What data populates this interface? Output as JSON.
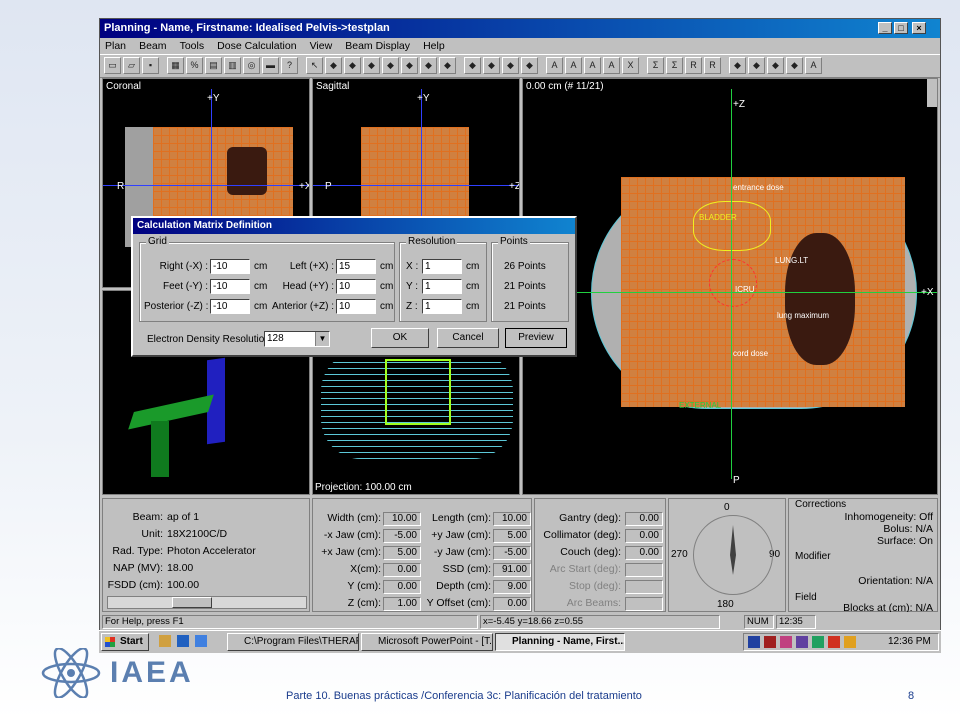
{
  "window": {
    "title": "Planning - Name, Firstname: Idealised Pelvis->testplan",
    "minimize": "_",
    "maximize": "□",
    "close": "×"
  },
  "menu": [
    "Plan",
    "Beam",
    "Tools",
    "Dose Calculation",
    "View",
    "Beam Display",
    "Help"
  ],
  "toolbar_icons": [
    "new-icon",
    "open-icon",
    "save-icon",
    "grid-icon",
    "percent-icon",
    "table-icon",
    "matrix-icon",
    "zoom-icon",
    "measure-icon",
    "help-icon",
    "arrow-icon",
    "beam-icon",
    "tool-icon",
    "tool2-icon",
    "tool3-icon",
    "tool4-icon",
    "tool5-icon",
    "tool6-icon",
    "layout-icon",
    "layout2-icon",
    "layout3-icon",
    "layout4-icon",
    "text-icon",
    "text2-icon",
    "text3-icon",
    "text4-icon",
    "text5-icon",
    "sigma-icon",
    "sigma2-icon",
    "rx-icon",
    "rx2-icon",
    "view-icon",
    "view2-icon",
    "view3-icon",
    "view4-icon",
    "font-icon"
  ],
  "views": {
    "coronal": {
      "label": "Coronal",
      "y": "+Y",
      "left": "R",
      "right": "+X"
    },
    "sagittal": {
      "label": "Sagittal",
      "y": "+Y",
      "left": "P",
      "right": "+Z",
      "projection": "Projection: 100.00 cm"
    },
    "axial": {
      "label": "0.00 cm (# 11/21)",
      "z": "+Z",
      "x": "+X",
      "p": "P",
      "annotations": {
        "entrance": "entrance dose",
        "bladder": "BLADDER",
        "lung_lt": "LUNG.LT",
        "icru": "ICRU",
        "lung_max": "lung maximum",
        "cord": "cord dose",
        "external": "EXTERNAL"
      }
    }
  },
  "dialog": {
    "title": "Calculation Matrix Definition",
    "grid_label": "Grid",
    "resolution_label": "Resolution",
    "points_label": "Points",
    "right_label": "Right (-X) :",
    "right_value": "-10",
    "feet_label": "Feet (-Y) :",
    "feet_value": "-10",
    "posterior_label": "Posterior (-Z) :",
    "posterior_value": "-10",
    "left_label": "Left (+X) :",
    "left_value": "15",
    "head_label": "Head (+Y) :",
    "head_value": "10",
    "anterior_label": "Anterior (+Z) :",
    "anterior_value": "10",
    "unit": "cm",
    "res_x_label": "X :",
    "res_x": "1",
    "res_y_label": "Y :",
    "res_y": "1",
    "res_z_label": "Z :",
    "res_z": "1",
    "points_x": "26 Points",
    "points_y": "21 Points",
    "points_z": "21 Points",
    "edr_label": "Electron Density Resolution:",
    "edr_value": "128",
    "ok": "OK",
    "cancel": "Cancel",
    "preview": "Preview"
  },
  "beam_info": {
    "beam_label": "Beam:",
    "beam": "ap of 1",
    "unit_label": "Unit:",
    "unit": "18X2100C/D",
    "radtype_label": "Rad. Type:",
    "radtype": "Photon Accelerator",
    "nap_label": "NAP (MV):",
    "nap": "18.00",
    "fsdd_label": "FSDD (cm):",
    "fsdd": "100.00"
  },
  "beam_geom": {
    "width_label": "Width (cm):",
    "width": "10.00",
    "xjaw_neg_label": "-x Jaw (cm):",
    "xjaw_neg": "-5.00",
    "xjaw_pos_label": "+x Jaw (cm):",
    "xjaw_pos": "5.00",
    "x_label": "X(cm):",
    "x": "0.00",
    "y_label": "Y (cm):",
    "y": "0.00",
    "z_label": "Z (cm):",
    "z": "1.00",
    "length_label": "Length (cm):",
    "length": "10.00",
    "yjaw_pos_label": "+y Jaw (cm):",
    "yjaw_pos": "5.00",
    "yjaw_neg_label": "-y Jaw (cm):",
    "yjaw_neg": "-5.00",
    "ssd_label": "SSD (cm):",
    "ssd": "91.00",
    "depth_label": "Depth (cm):",
    "depth": "9.00",
    "yoffset_label": "Y Offset (cm):",
    "yoffset": "0.00"
  },
  "gantry": {
    "gantry_label": "Gantry (deg):",
    "gantry": "0.00",
    "collimator_label": "Collimator (deg):",
    "collimator": "0.00",
    "couch_label": "Couch (deg):",
    "couch": "0.00",
    "arcstart_label": "Arc Start (deg):",
    "stop_label": "Stop (deg):",
    "arcbeams_label": "Arc Beams:"
  },
  "dial": {
    "top": "0",
    "left": "270",
    "right": "90",
    "bottom": "180",
    "angle_deg": 0
  },
  "corrections": {
    "title": "Corrections",
    "inhomogeneity": "Inhomogeneity: Off",
    "bolus": "Bolus: N/A",
    "surface": "Surface: On",
    "modifier_title": "Modifier",
    "orientation": "Orientation: N/A",
    "field_title": "Field",
    "blocks": "Blocks at (cm): N/A"
  },
  "statusbar": {
    "help": "For Help, press F1",
    "coords": "x=-5.45 y=18.66 z=0.55",
    "num": "NUM",
    "time": "12:35"
  },
  "taskbar": {
    "start": "Start",
    "tasks": [
      "C:\\Program Files\\THERAP...",
      "Microsoft PowerPoint - [T...",
      "Planning - Name, First..."
    ],
    "clock": "12:36 PM"
  },
  "slide": {
    "logo": "IAEA",
    "footer": "Parte 10. Buenas prácticas /Conferencia  3c: Planificación del tratamiento",
    "page": "8"
  },
  "colors": {
    "accent": "#000080",
    "grid": "#e07020",
    "logo": "#5b7fb0"
  }
}
